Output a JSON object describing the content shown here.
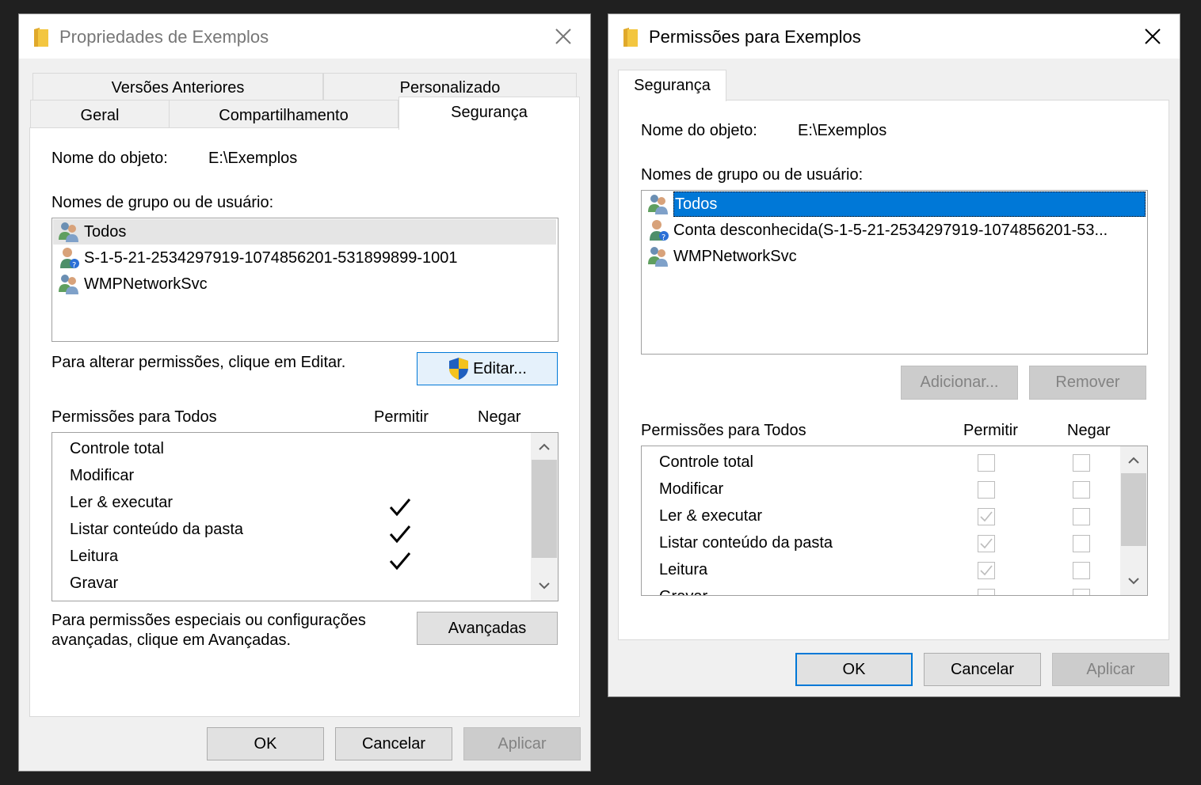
{
  "left": {
    "title": "Propriedades de Exemplos",
    "tabs_row1": [
      "Versões Anteriores",
      "Personalizado"
    ],
    "tabs_row2": [
      "Geral",
      "Compartilhamento",
      "Segurança"
    ],
    "object_label": "Nome do objeto:",
    "object_value": "E:\\Exemplos",
    "group_label": "Nomes de grupo ou de usuário:",
    "users": [
      {
        "name": "Todos",
        "icon": "users-group-icon"
      },
      {
        "name": "S-1-5-21-2534297919-1074856201-531899899-1001",
        "icon": "unknown-user-icon"
      },
      {
        "name": "WMPNetworkSvc",
        "icon": "users-group-icon"
      }
    ],
    "change_hint": "Para alterar permissões, clique em Editar.",
    "edit_button": "Editar...",
    "perm_header": "Permissões para Todos",
    "allow_header": "Permitir",
    "deny_header": "Negar",
    "permissions": [
      {
        "name": "Controle total",
        "allow": false,
        "deny": false
      },
      {
        "name": "Modificar",
        "allow": false,
        "deny": false
      },
      {
        "name": "Ler & executar",
        "allow": true,
        "deny": false
      },
      {
        "name": "Listar conteúdo da pasta",
        "allow": true,
        "deny": false
      },
      {
        "name": "Leitura",
        "allow": true,
        "deny": false
      },
      {
        "name": "Gravar",
        "allow": false,
        "deny": false
      }
    ],
    "advanced_hint_1": "Para permissões especiais ou configurações",
    "advanced_hint_2": "avançadas, clique em Avançadas.",
    "advanced_button": "Avançadas",
    "ok": "OK",
    "cancel": "Cancelar",
    "apply": "Aplicar"
  },
  "right": {
    "title": "Permissões para Exemplos",
    "tab": "Segurança",
    "object_label": "Nome do objeto:",
    "object_value": "E:\\Exemplos",
    "group_label": "Nomes de grupo ou de usuário:",
    "users": [
      {
        "name": "Todos",
        "icon": "users-group-icon"
      },
      {
        "name": "Conta desconhecida(S-1-5-21-2534297919-1074856201-53...",
        "icon": "unknown-user-icon"
      },
      {
        "name": "WMPNetworkSvc",
        "icon": "users-group-icon"
      }
    ],
    "add_button": "Adicionar...",
    "remove_button": "Remover",
    "perm_header": "Permissões para Todos",
    "allow_header": "Permitir",
    "deny_header": "Negar",
    "permissions": [
      {
        "name": "Controle total",
        "allow": false,
        "deny": false
      },
      {
        "name": "Modificar",
        "allow": false,
        "deny": false
      },
      {
        "name": "Ler & executar",
        "allow": true,
        "deny": false
      },
      {
        "name": "Listar conteúdo da pasta",
        "allow": true,
        "deny": false
      },
      {
        "name": "Leitura",
        "allow": true,
        "deny": false
      },
      {
        "name": "Gravar",
        "allow": false,
        "deny": false
      }
    ],
    "ok": "OK",
    "cancel": "Cancelar",
    "apply": "Aplicar"
  },
  "colors": {
    "selection": "#0078d7",
    "folder": "#f3c640",
    "background": "#202020"
  }
}
